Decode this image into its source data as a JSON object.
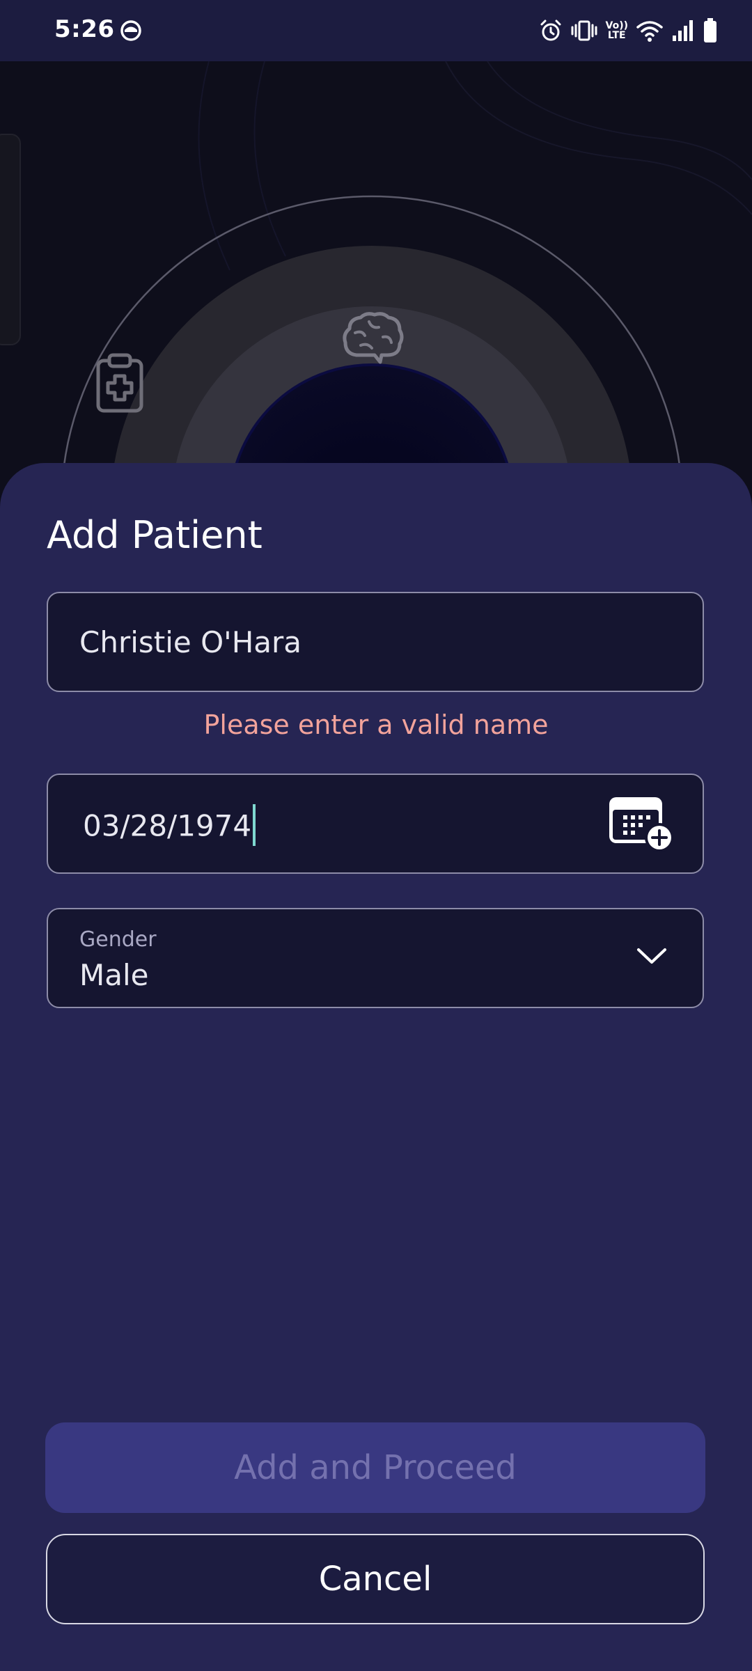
{
  "status_bar": {
    "time": "5:26",
    "network_label_top": "Vo))",
    "network_label_bottom": "LTE",
    "icons": [
      "app-notification-icon",
      "alarm-icon",
      "vibrate-icon",
      "volte-icon",
      "wifi-icon",
      "signal-icon",
      "battery-icon"
    ]
  },
  "hero": {
    "icons": [
      "clipboard-medical-icon",
      "brain-icon"
    ]
  },
  "sheet": {
    "title": "Add Patient",
    "name_field": {
      "value": "Christie O'Hara",
      "error": "Please enter a valid name"
    },
    "dob_field": {
      "value": "03/28/1974",
      "icon": "calendar-add-icon"
    },
    "gender_field": {
      "label": "Gender",
      "value": "Male",
      "icon": "chevron-down-icon"
    },
    "primary_button": "Add and Proceed",
    "secondary_button": "Cancel"
  },
  "colors": {
    "sheet_background": "#262553",
    "field_background": "#151530",
    "error_text": "#f2a39b",
    "primary_button_disabled": "#393881",
    "primary_button_text_disabled": "#7471ae",
    "caret": "#7fd8d0",
    "status_bar": "#1c1c40"
  }
}
